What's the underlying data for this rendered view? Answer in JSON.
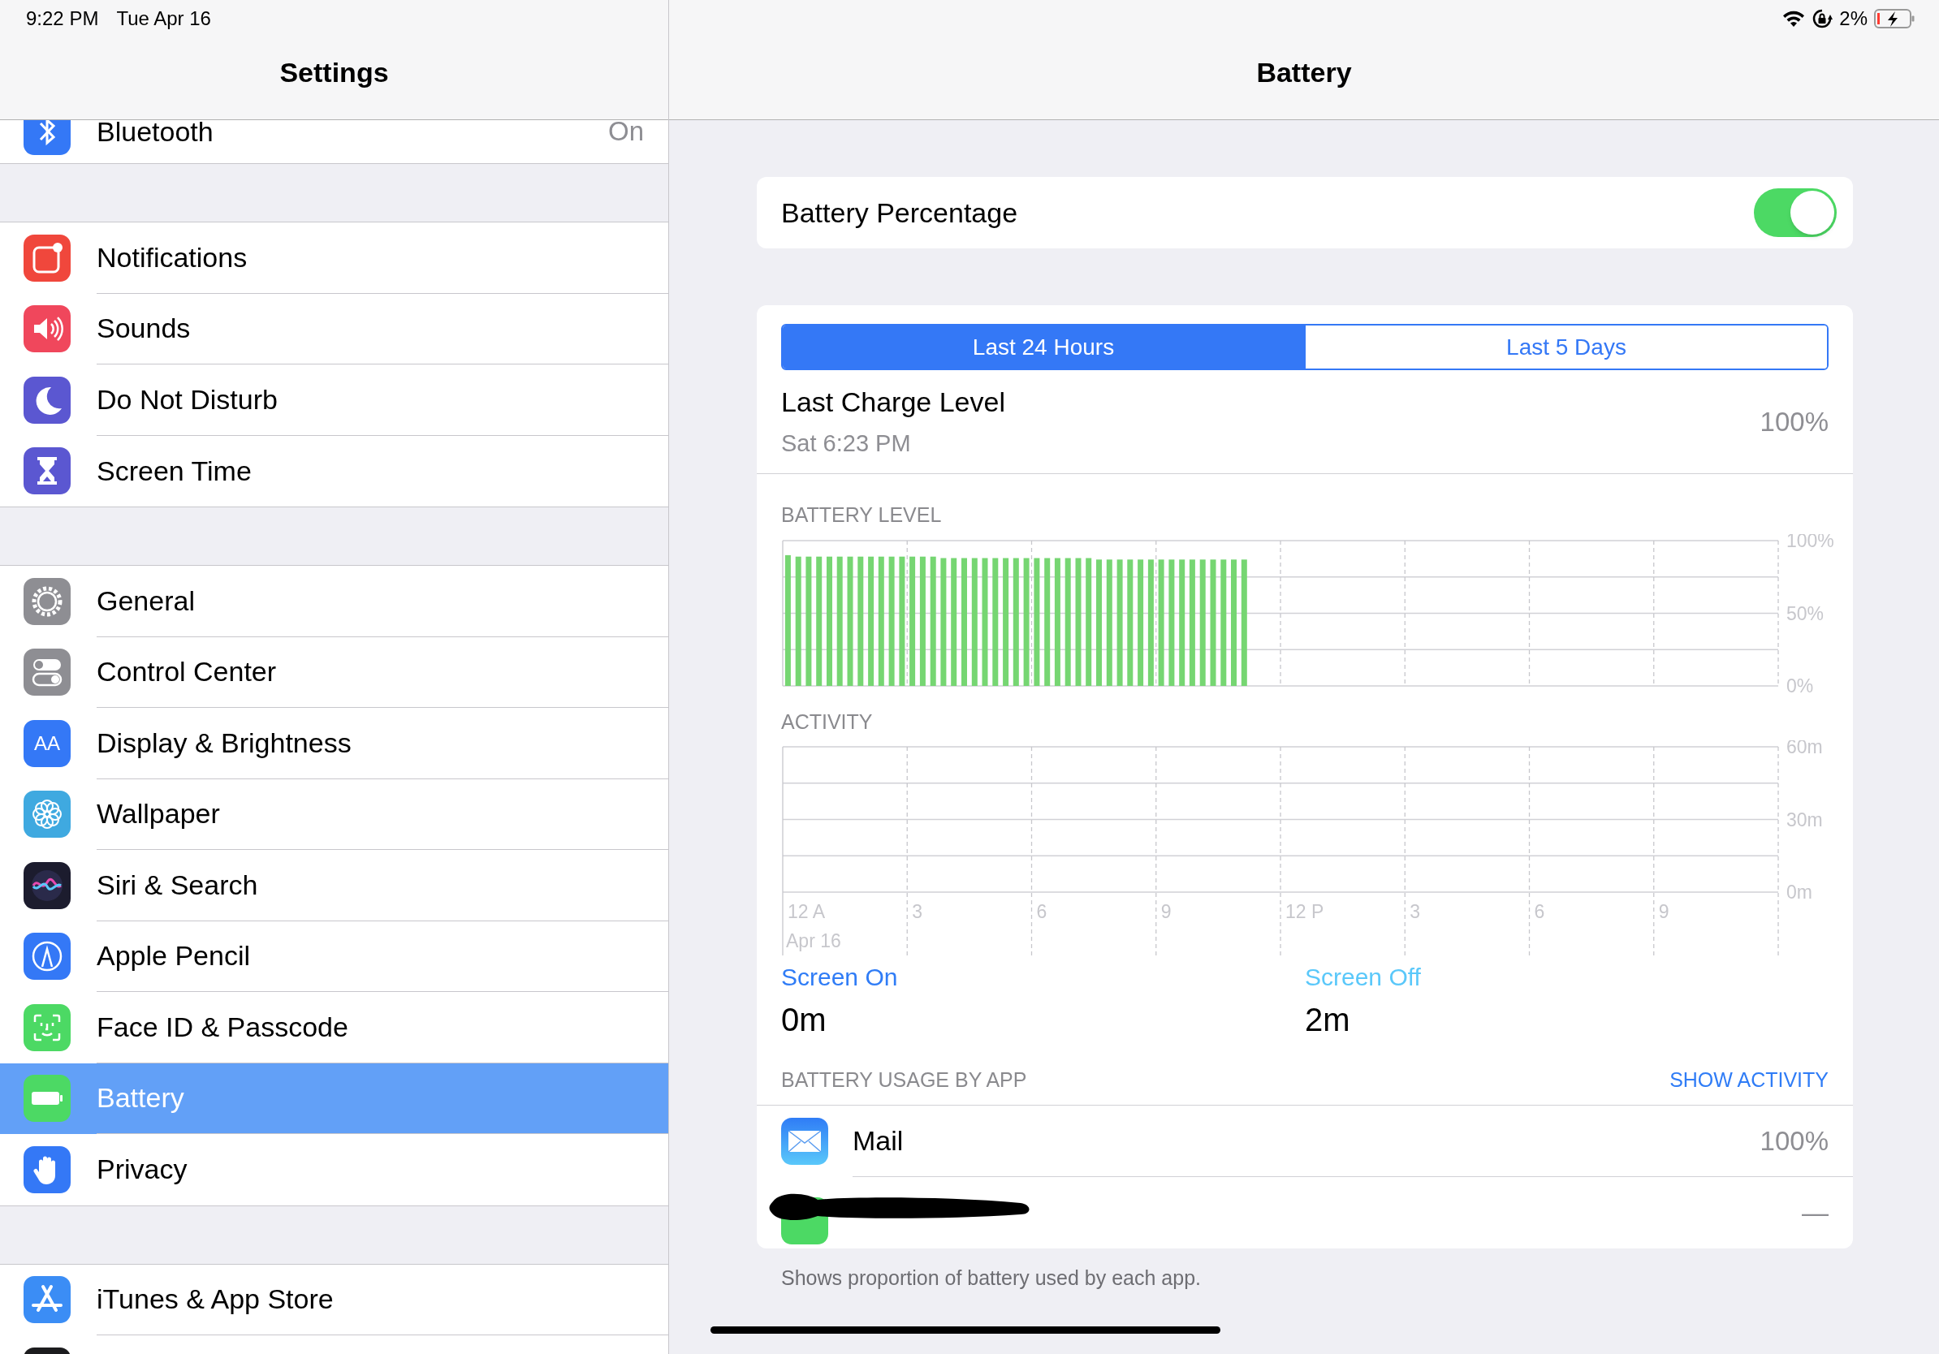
{
  "status_bar": {
    "time": "9:22 PM",
    "date": "Tue Apr 16",
    "battery": "2%"
  },
  "sidebar": {
    "title": "Settings",
    "groups": [
      [
        {
          "label": "Bluetooth",
          "value": "On",
          "selected": false
        }
      ],
      [
        {
          "label": "Notifications",
          "selected": false
        },
        {
          "label": "Sounds",
          "selected": false
        },
        {
          "label": "Do Not Disturb",
          "selected": false
        },
        {
          "label": "Screen Time",
          "selected": false
        }
      ],
      [
        {
          "label": "General",
          "selected": false
        },
        {
          "label": "Control Center",
          "selected": false
        },
        {
          "label": "Display & Brightness",
          "icon_text": "AA",
          "selected": false
        },
        {
          "label": "Wallpaper",
          "selected": false
        },
        {
          "label": "Siri & Search",
          "selected": false
        },
        {
          "label": "Apple Pencil",
          "selected": false
        },
        {
          "label": "Face ID & Passcode",
          "selected": false
        },
        {
          "label": "Battery",
          "selected": true
        },
        {
          "label": "Privacy",
          "selected": false
        }
      ],
      [
        {
          "label": "iTunes & App Store",
          "selected": false
        },
        {
          "selected": false
        }
      ]
    ]
  },
  "detail": {
    "title": "Battery",
    "battery_percentage": {
      "label": "Battery Percentage",
      "on": true
    },
    "segments": [
      {
        "label": "Last 24 Hours",
        "selected": true
      },
      {
        "label": "Last 5 Days",
        "selected": false
      }
    ],
    "last_charge": {
      "label": "Last Charge Level",
      "time": "Sat 6:23 PM",
      "value": "100%"
    },
    "battery_level": {
      "chart_data": {
        "type": "bar",
        "title": "BATTERY LEVEL",
        "categories": [
          null,
          null,
          null,
          null,
          null,
          null,
          null,
          null,
          null,
          null,
          null,
          null,
          null,
          null,
          null,
          null,
          null,
          null,
          null,
          null,
          null,
          null,
          null,
          null,
          null,
          null,
          null,
          null,
          null,
          null,
          null,
          null,
          null,
          null,
          null,
          null,
          null,
          null,
          null,
          null,
          null,
          null,
          null,
          null,
          null,
          null,
          null,
          null,
          null,
          null,
          null,
          null,
          null,
          null,
          null,
          null,
          null,
          null,
          null,
          null,
          null,
          null,
          null,
          null,
          null,
          null,
          null,
          null,
          null,
          null,
          null,
          null,
          null,
          null,
          null,
          null,
          null,
          null,
          null,
          null,
          null,
          null,
          null,
          null,
          null,
          null,
          null,
          null,
          null,
          null,
          null,
          null,
          null,
          null,
          null,
          null
        ],
        "series": [
          {
            "color": "#76d672",
            "values": [
              90,
              89,
              89,
              89,
              89,
              89,
              89,
              89,
              89,
              89,
              89,
              89,
              89,
              89,
              89,
              88,
              88,
              88,
              88,
              88,
              88,
              88,
              88,
              88,
              88,
              88,
              88,
              88,
              88,
              88,
              87,
              87,
              87,
              87,
              87,
              87,
              87,
              87,
              87,
              87,
              87,
              87,
              87,
              87,
              87,
              null,
              null,
              null,
              null,
              null,
              null,
              null,
              null,
              null,
              null,
              null,
              null,
              null,
              null,
              null,
              null,
              null,
              null,
              null,
              null,
              null,
              null,
              null,
              null,
              null,
              null,
              null,
              null,
              null,
              null,
              null,
              null,
              null,
              null,
              null,
              null,
              null,
              null,
              null,
              null,
              null,
              null,
              null,
              null,
              null,
              null,
              null,
              null,
              null,
              null,
              null
            ]
          }
        ],
        "grid": true,
        "ylim": [
          0,
          100
        ],
        "yticks": [
          {
            "value": 0,
            "label": "0%"
          },
          {
            "value": 50,
            "label": "50%"
          },
          {
            "value": 100,
            "label": "100%"
          }
        ]
      }
    },
    "activity": {
      "chart_data": {
        "type": "bar",
        "title": "ACTIVITY",
        "categories": [
          "12 A",
          "3",
          "6",
          "9",
          "12 P",
          "3",
          "6",
          "9"
        ],
        "ylim": [
          0,
          60
        ],
        "yticks": [
          {
            "value": 0,
            "label": "0m"
          },
          {
            "value": 30,
            "label": "30m"
          },
          {
            "value": 60,
            "label": "60m"
          }
        ]
      },
      "date_label": "Apr 16"
    },
    "screen_on": {
      "label": "Screen On",
      "value": "0m"
    },
    "screen_off": {
      "label": "Screen Off",
      "value": "2m"
    },
    "usage": {
      "title": "BATTERY USAGE BY APP",
      "action": "SHOW ACTIVITY",
      "apps": [
        {
          "kind": "app",
          "name": "Mail",
          "value": "100%"
        },
        {
          "kind": "redacted",
          "value": "—"
        }
      ]
    },
    "footer": "Shows proportion of battery used by each app."
  }
}
